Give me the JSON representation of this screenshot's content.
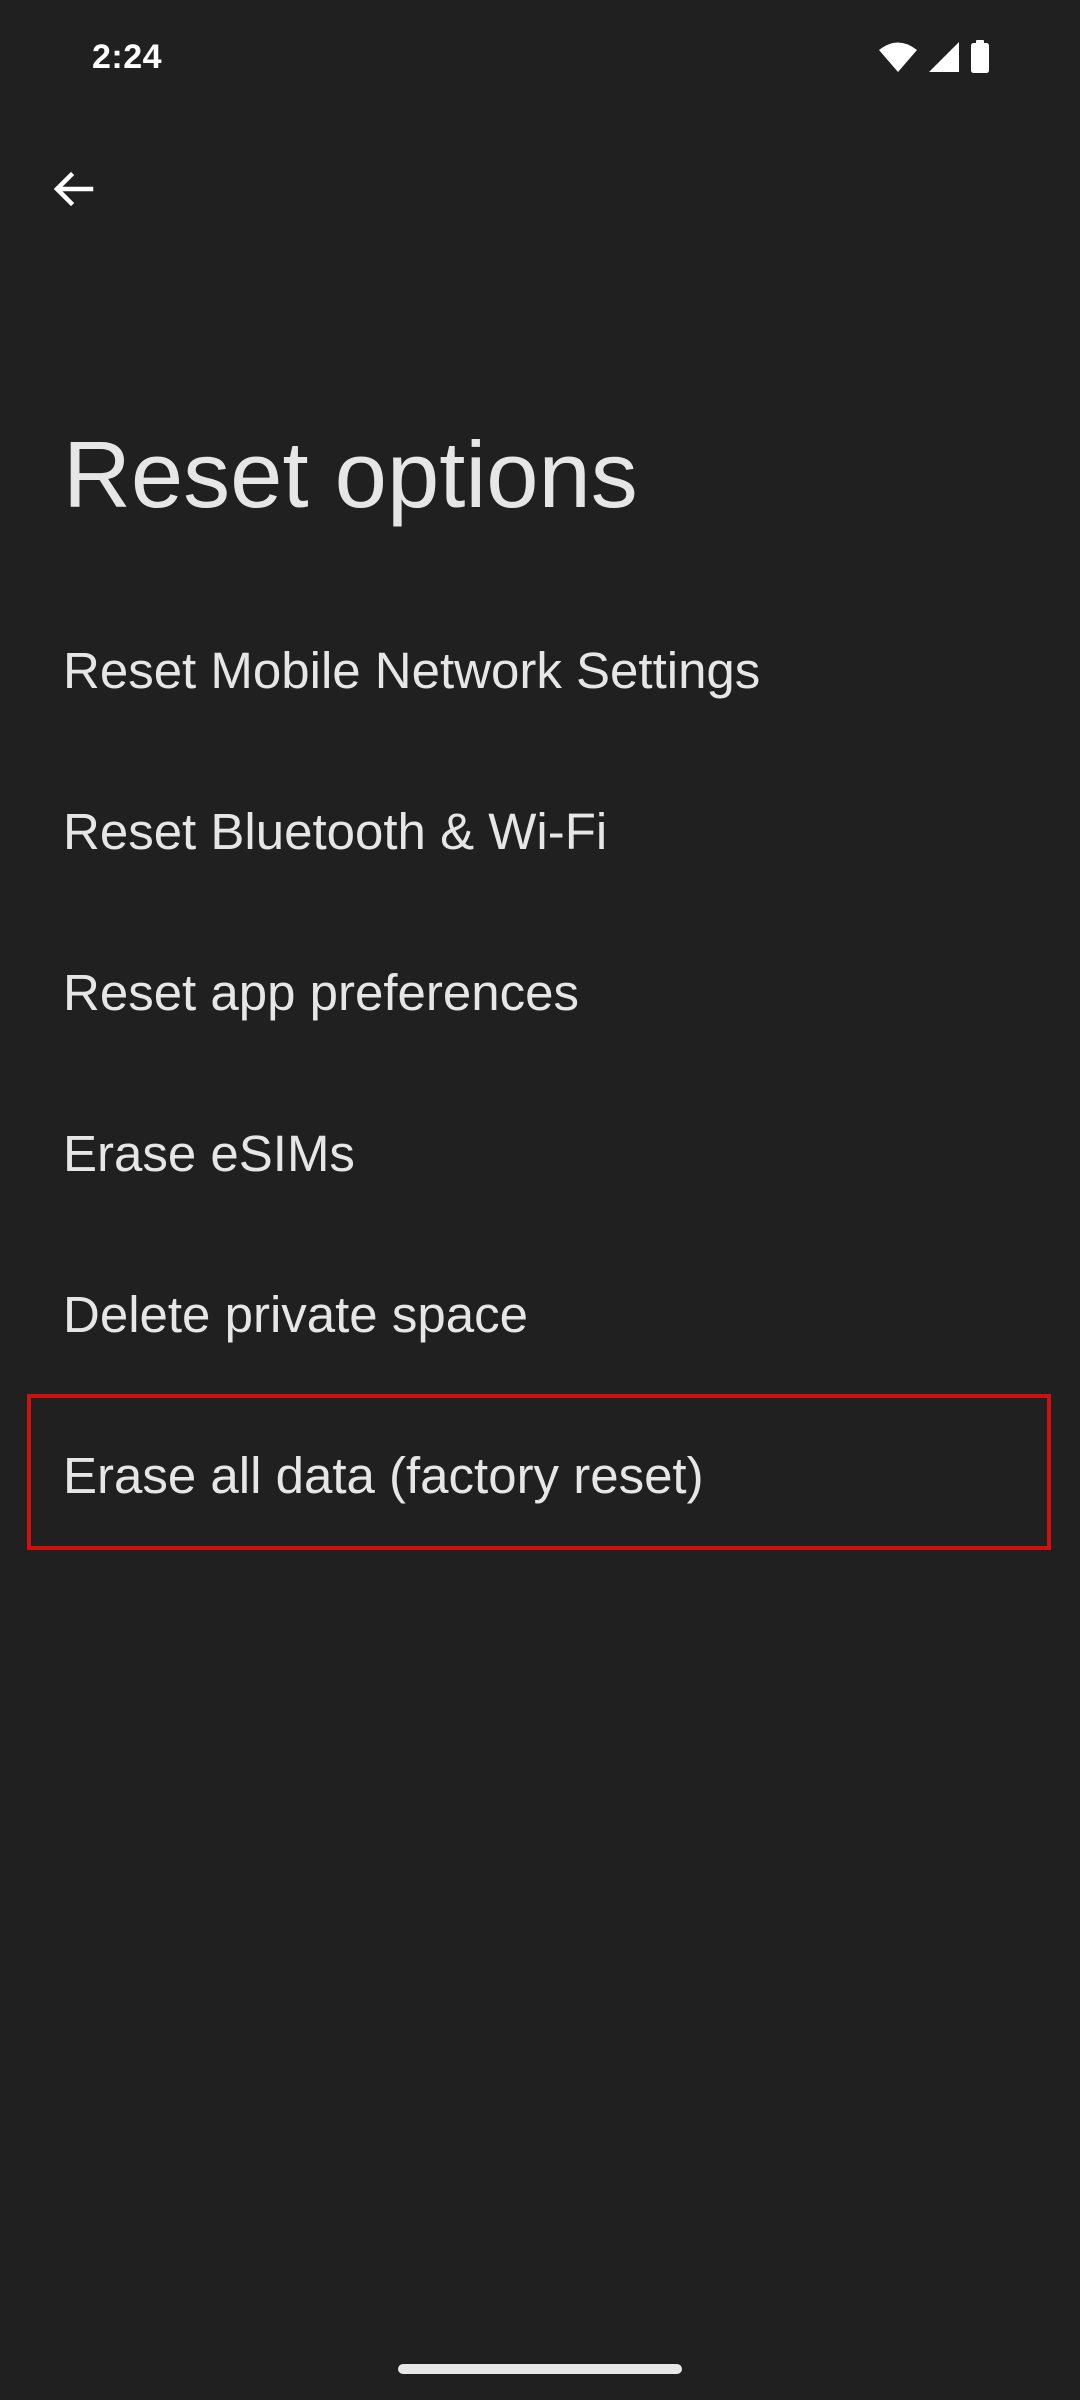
{
  "status_bar": {
    "time": "2:24",
    "icons": [
      "wifi-icon",
      "cell-signal-icon",
      "battery-icon"
    ]
  },
  "header": {
    "back_icon": "arrow-back-icon",
    "title": "Reset options"
  },
  "options": [
    {
      "label": "Reset Mobile Network Settings"
    },
    {
      "label": "Reset Bluetooth & Wi-Fi"
    },
    {
      "label": "Reset app preferences"
    },
    {
      "label": "Erase eSIMs"
    },
    {
      "label": "Delete private space"
    },
    {
      "label": "Erase all data (factory reset)",
      "highlighted": true
    }
  ],
  "colors": {
    "background": "#202020",
    "text": "#e6e6e6",
    "highlight": "#d01010"
  }
}
